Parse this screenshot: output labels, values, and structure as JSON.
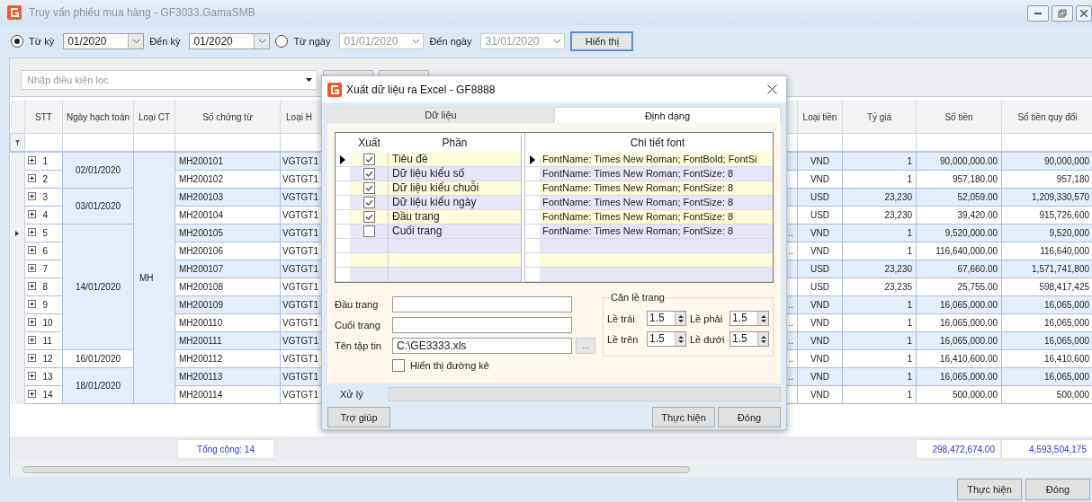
{
  "window": {
    "title": "Truy vấn phiếu mua hàng - GF3033.GamaSMB"
  },
  "period": {
    "by_period": {
      "label": "Từ kỳ",
      "selected": true,
      "from": "01/2020",
      "to_label": "Đến kỳ",
      "to": "01/2020"
    },
    "by_date": {
      "label": "Từ ngày",
      "selected": false,
      "from": "01/01/2020",
      "to_label": "Đến ngày",
      "to": "31/01/2020"
    },
    "show_button": "Hiển thị"
  },
  "filter_box": {
    "placeholder": "Nhập điều kiện lọc"
  },
  "grid": {
    "columns": [
      "STT",
      "Ngày hạch toán",
      "Loại CT",
      "Số chứng từ",
      "Loại H",
      "Loại tiền",
      "Tỷ giá",
      "Số tiền",
      "Số tiền quy đổi"
    ],
    "loai_ct": "MH",
    "date_groups": [
      {
        "date": "02/01/2020",
        "rows": [
          {
            "stt": "1",
            "so_ct": "MH200101",
            "loai_hd": "VGTGT1",
            "column_6": "",
            "loai_tien": "VND",
            "ty_gia": "1",
            "so_tien": "90,000,000.00",
            "quy_doi": "90,000,000",
            "current": false
          },
          {
            "stt": "2",
            "so_ct": "MH200102",
            "loai_hd": "VGTGT1",
            "column_6": "",
            "loai_tien": "VND",
            "ty_gia": "1",
            "so_tien": "957,180.00",
            "quy_doi": "957,180",
            "current": false
          }
        ]
      },
      {
        "date": "03/01/2020",
        "rows": [
          {
            "stt": "3",
            "so_ct": "MH200103",
            "loai_hd": "VGTGT1",
            "column_6": "",
            "loai_tien": "USD",
            "ty_gia": "23,230",
            "so_tien": "52,059.00",
            "quy_doi": "1,209,330,570",
            "current": false
          },
          {
            "stt": "4",
            "so_ct": "MH200104",
            "loai_hd": "VGTGT1",
            "column_6": "",
            "loai_tien": "USD",
            "ty_gia": "23,230",
            "so_tien": "39,420.00",
            "quy_doi": "915,726,600",
            "current": false
          }
        ]
      },
      {
        "date": "14/01/2020",
        "rows": [
          {
            "stt": "5",
            "so_ct": "MH200105",
            "loai_hd": "VGTGT1",
            "column_6": "..",
            "loai_tien": "VND",
            "ty_gia": "1",
            "so_tien": "9,520,000.00",
            "quy_doi": "9,520,000",
            "current": true
          },
          {
            "stt": "6",
            "so_ct": "MH200106",
            "loai_hd": "VGTGT1",
            "column_6": "..",
            "loai_tien": "VND",
            "ty_gia": "1",
            "so_tien": "116,640,000.00",
            "quy_doi": "116,640,000",
            "current": false
          },
          {
            "stt": "7",
            "so_ct": "MH200107",
            "loai_hd": "VGTGT1",
            "column_6": "",
            "loai_tien": "USD",
            "ty_gia": "23,230",
            "so_tien": "67,660.00",
            "quy_doi": "1,571,741,800",
            "current": false
          },
          {
            "stt": "8",
            "so_ct": "MH200108",
            "loai_hd": "VGTGT1",
            "column_6": "",
            "loai_tien": "USD",
            "ty_gia": "23,235",
            "so_tien": "25,755.00",
            "quy_doi": "598,417,425",
            "current": false
          },
          {
            "stt": "9",
            "so_ct": "MH200109",
            "loai_hd": "VGTGT1",
            "column_6": "..",
            "loai_tien": "VND",
            "ty_gia": "1",
            "so_tien": "16,065,000.00",
            "quy_doi": "16,065,000",
            "current": false
          },
          {
            "stt": "10",
            "so_ct": "MH200110",
            "loai_hd": "VGTGT1",
            "column_6": "..",
            "loai_tien": "VND",
            "ty_gia": "1",
            "so_tien": "16,065,000.00",
            "quy_doi": "16,065,000",
            "current": false
          },
          {
            "stt": "11",
            "so_ct": "MH200111",
            "loai_hd": "VGTGT1",
            "column_6": "..",
            "loai_tien": "VND",
            "ty_gia": "1",
            "so_tien": "16,065,000.00",
            "quy_doi": "16,065,000",
            "current": false
          }
        ]
      },
      {
        "date": "16/01/2020",
        "rows": [
          {
            "stt": "12",
            "so_ct": "MH200112",
            "loai_hd": "VGTGT1",
            "column_6": "..",
            "loai_tien": "VND",
            "ty_gia": "1",
            "so_tien": "16,410,600.00",
            "quy_doi": "16,410,600",
            "current": false
          }
        ]
      },
      {
        "date": "18/01/2020",
        "rows": [
          {
            "stt": "13",
            "so_ct": "MH200113",
            "loai_hd": "VGTGT1",
            "column_6": "..",
            "loai_tien": "VND",
            "ty_gia": "1",
            "so_tien": "16,065,000.00",
            "quy_doi": "16,065,000",
            "current": false
          },
          {
            "stt": "14",
            "so_ct": "MH200114",
            "loai_hd": "VGTGT1",
            "column_6": "",
            "loai_tien": "VND",
            "ty_gia": "1",
            "so_tien": "500,000.00",
            "quy_doi": "500,000",
            "current": false
          }
        ]
      }
    ],
    "totals": {
      "label": "Tổng cộng: 14",
      "so_tien": "298,472,674.00",
      "quy_doi": "4,593,504,175"
    }
  },
  "buttons": [
    "Thực hiện",
    "Đóng"
  ],
  "dialog": {
    "title": "Xuất dữ liệu ra Excel - GF8888",
    "tabs": [
      {
        "label": "Dữ liệu",
        "selected": false
      },
      {
        "label": "Định dạng",
        "selected": true
      }
    ],
    "parts_grid": {
      "columns": [
        "Xuất",
        "Phần"
      ],
      "rows": [
        {
          "label": "Tiêu đề",
          "checked": true,
          "current": true
        },
        {
          "label": "Dữ liệu kiểu số",
          "checked": true,
          "current": false
        },
        {
          "label": "Dữ liệu kiểu chuỗi",
          "checked": true,
          "current": false
        },
        {
          "label": "Dữ liệu kiểu ngày",
          "checked": true,
          "current": false
        },
        {
          "label": "Đầu trang",
          "checked": true,
          "current": false
        },
        {
          "label": "Cuối trang",
          "checked": false,
          "current": false
        }
      ]
    },
    "font_grid": {
      "column": "Chi tiết font",
      "rows": [
        {
          "text": "FontName: Times New Roman; FontBold; FontSi",
          "current": true
        },
        {
          "text": "FontName: Times New Roman; FontSize: 8",
          "current": false
        },
        {
          "text": "FontName: Times New Roman; FontSize: 8",
          "current": false
        },
        {
          "text": "FontName: Times New Roman; FontSize: 8",
          "current": false
        },
        {
          "text": "FontName: Times New Roman; FontSize: 8",
          "current": false
        },
        {
          "text": "FontName: Times New Roman; FontSize: 8",
          "current": false
        }
      ]
    },
    "fields": [
      {
        "label": "Đầu trang"
      },
      {
        "label": "Cuối trang"
      },
      {
        "label": "Tên tập tin",
        "value": "C:\\GE3333.xls",
        "browse": "..."
      }
    ],
    "grid_lines": {
      "label": "Hiển thị đường kẻ",
      "checked": false
    },
    "margins": {
      "title": "Căn lề trang",
      "items": [
        {
          "label": "Lề trái",
          "value": "1.5"
        },
        {
          "label": "Lề phải",
          "value": "1.5"
        },
        {
          "label": "Lề trên",
          "value": "1.5"
        },
        {
          "label": "Lề dưới",
          "value": "1.5"
        }
      ]
    },
    "progress": {
      "label": "Xử lý",
      "level": 0
    },
    "help_button": "Trợ giúp",
    "buttons": [
      "Thực hiện",
      "Đóng"
    ]
  }
}
